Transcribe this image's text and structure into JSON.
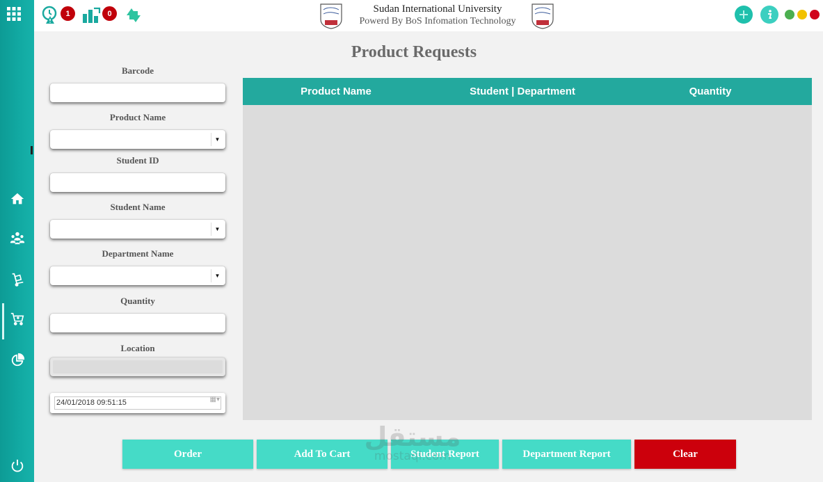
{
  "topbar": {
    "alerts_badge": "1",
    "stock_badge": "0",
    "university_name": "Sudan International University",
    "powered_by": "Powerd By BoS Infomation Technology"
  },
  "page": {
    "title": "Product Requests"
  },
  "form": {
    "barcode_label": "Barcode",
    "product_name_label": "Product Name",
    "student_id_label": "Student ID",
    "student_name_label": "Student Name",
    "department_name_label": "Department Name",
    "quantity_label": "Quantity",
    "location_label": "Location",
    "datetime_value": "24/01/2018  09:51:15"
  },
  "table": {
    "columns": [
      "Product Name",
      "Student | Department",
      "Quantity"
    ],
    "rows": []
  },
  "actions": {
    "order": "Order",
    "add_to_cart": "Add To Cart",
    "student_report": "Student Report",
    "department_report": "Department Report",
    "clear": "Clear"
  },
  "watermark": {
    "arabic": "مستقل",
    "latin": "mostaql.com"
  },
  "colors": {
    "sidebar": "#12aaa3",
    "table_header": "#23a99e",
    "button_teal": "#45dbc7",
    "button_red": "#cc000c",
    "badge_red": "#c0000a",
    "dot_green": "#4caf50",
    "dot_yellow": "#f2c200",
    "dot_red": "#d0021b"
  },
  "icons": {
    "sidebar": [
      "apps-grid-icon",
      "home-icon",
      "users-icon",
      "hand-truck-icon",
      "cart-icon",
      "pie-chart-icon",
      "power-icon"
    ],
    "topbar": [
      "alert-clock-icon",
      "stock-chart-icon",
      "sync-arrows-icon",
      "plus-icon",
      "info-icon"
    ]
  }
}
